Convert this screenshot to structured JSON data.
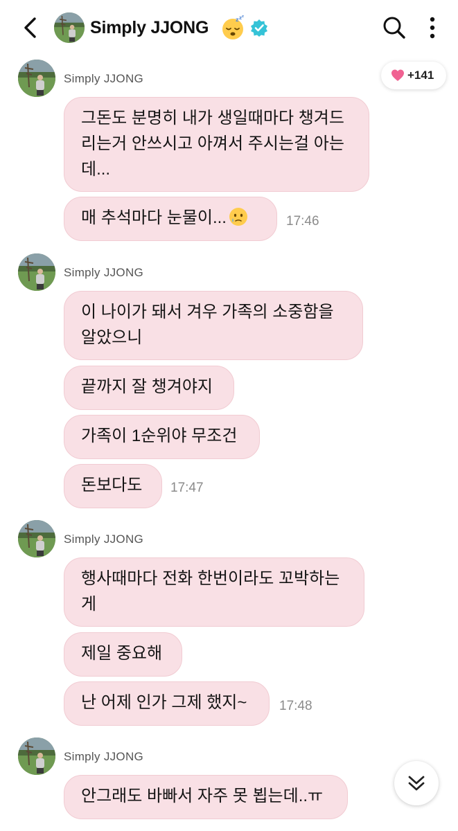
{
  "header": {
    "title": "Simply JJONG",
    "back_icon": "chevron-left-icon",
    "emoji": "sleeping-face-emoji",
    "verified_icon": "verified-badge-icon",
    "search_icon": "search-icon",
    "more_icon": "more-vertical-icon"
  },
  "reaction": {
    "icon": "heart-icon",
    "count": "+141",
    "color": "#f06292"
  },
  "colors": {
    "bubble_bg": "#f9e0e5",
    "bubble_border": "#f1cbd2",
    "verified": "#35c3d7"
  },
  "messages": [
    {
      "sender": "Simply JJONG",
      "bubbles": [
        {
          "text": "그돈도 분명히 내가 생일때마다 챙겨드리는거 안쓰시고 아껴서 주시는걸 아는데..."
        },
        {
          "text": "매 추석마다 눈물이...",
          "emoji": "face-holding-back-tears-emoji",
          "time": "17:46"
        }
      ]
    },
    {
      "sender": "Simply JJONG",
      "bubbles": [
        {
          "text": "이 나이가 돼서 겨우 가족의 소중함을 알았으니"
        },
        {
          "text": "끝까지 잘 챙겨야지"
        },
        {
          "text": "가족이 1순위야 무조건"
        },
        {
          "text": "돈보다도",
          "time": "17:47"
        }
      ]
    },
    {
      "sender": "Simply JJONG",
      "bubbles": [
        {
          "text": "행사때마다 전화 한번이라도 꼬박하는게"
        },
        {
          "text": "제일 중요해"
        },
        {
          "text": "난 어제 인가 그제 했지~",
          "time": "17:48"
        }
      ]
    },
    {
      "sender": "Simply JJONG",
      "bubbles": [
        {
          "text": "안그래도 바빠서 자주 못 뵙는데..ㅠ"
        }
      ]
    }
  ],
  "scroll_button_icon": "double-chevron-down-icon"
}
